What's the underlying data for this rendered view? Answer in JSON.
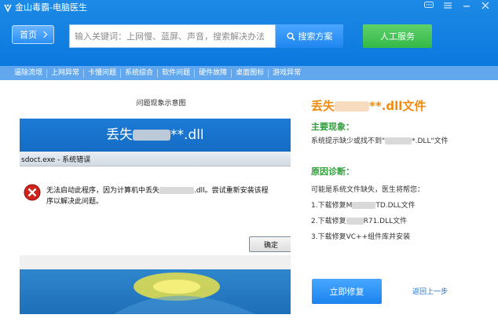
{
  "app": {
    "title": "金山毒霸-电脑医生",
    "window_controls": [
      "chat-icon",
      "menu-icon",
      "minimize-icon",
      "close-icon"
    ]
  },
  "toolbar": {
    "home_label": "首页",
    "search": {
      "placeholder": "输入关键词：上网慢、蓝屏、声音，搜索解决办法",
      "button_label": "搜索方案"
    },
    "service_label": "人工服务"
  },
  "nav": {
    "items": [
      "逼除流氓",
      "上网异常",
      "卡慢问题",
      "系统综合",
      "软件问题",
      "硬件故障",
      "桌面图标",
      "游戏异常"
    ]
  },
  "left": {
    "caption": "问题现象示意图",
    "shot": {
      "title_prefix": "丢失",
      "title_suffix": "**.dll",
      "dialog_title": "sdoct.exe - 系统错误",
      "error_line1_prefix": "无法启动此程序，因为计算机中丢失",
      "error_line1_suffix": ".dll。尝试重新安装该程",
      "error_line2": "序以解决此问题。",
      "ok_label": "确定"
    }
  },
  "right": {
    "title_prefix": "丢失",
    "title_suffix": "**.dll文件",
    "symptom_heading": "主要现象：",
    "symptom_prefix": "系统提示缺少或找不到\"",
    "symptom_suffix": "*.DLL\"文件",
    "diagnosis_heading": "原因诊断：",
    "diagnosis_text": "可能是系统文件缺失，医生将帮您：",
    "steps": [
      {
        "prefix": "1.下载修复M",
        "suffix": "TD.DLL文件"
      },
      {
        "prefix": "2.下载修复",
        "suffix": "R71.DLL文件"
      },
      {
        "prefix": "3.下载修复VC++组件库并安装",
        "suffix": ""
      }
    ],
    "fix_label": "立即修复",
    "back_label": "返回上一步"
  },
  "colors": {
    "header_blue": "#0a78de",
    "nav_blue": "#62a7ee",
    "accent_orange": "#f08a10",
    "heading_green": "#2e9e3a",
    "service_green": "#35b947",
    "link_blue": "#1a73d1"
  }
}
